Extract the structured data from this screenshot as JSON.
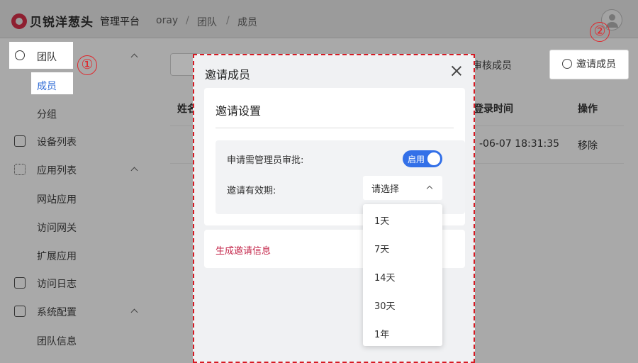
{
  "header": {
    "logo_text": "贝锐洋葱头",
    "platform": "管理平台",
    "breadcrumb": [
      "oray",
      "团队",
      "成员"
    ]
  },
  "sidebar": {
    "items": [
      {
        "label": "团队",
        "icon": "team-icon",
        "expanded": true
      },
      {
        "label": "成员"
      },
      {
        "label": "分组"
      },
      {
        "label": "设备列表",
        "icon": "device-icon"
      },
      {
        "label": "应用列表",
        "icon": "apps-icon",
        "expanded": true
      },
      {
        "label": "网站应用"
      },
      {
        "label": "访问网关"
      },
      {
        "label": "扩展应用"
      },
      {
        "label": "访问日志",
        "icon": "log-icon"
      },
      {
        "label": "系统配置",
        "icon": "settings-icon",
        "expanded": true
      },
      {
        "label": "团队信息"
      }
    ]
  },
  "main": {
    "review_label": "审核成员",
    "invite_label": "邀请成员",
    "table": {
      "headers": [
        "姓名",
        "登录时间",
        "操作"
      ],
      "row": {
        "login_time": "-06-07 18:31:35",
        "action": "移除"
      }
    }
  },
  "annotations": [
    "①",
    "②"
  ],
  "modal": {
    "title": "邀请成员",
    "section_title": "邀请设置",
    "approval_label": "申请需管理员审批:",
    "toggle_label": "启用",
    "toggle_on": true,
    "validity_label": "邀请有效期:",
    "select_placeholder": "请选择",
    "generate_label": "生成邀请信息",
    "options": [
      "1天",
      "7天",
      "14天",
      "30天",
      "1年"
    ]
  },
  "colors": {
    "primary": "#3370e8",
    "link": "#c4264a",
    "annotation": "#e0262b",
    "brand": "#8e1f30"
  }
}
